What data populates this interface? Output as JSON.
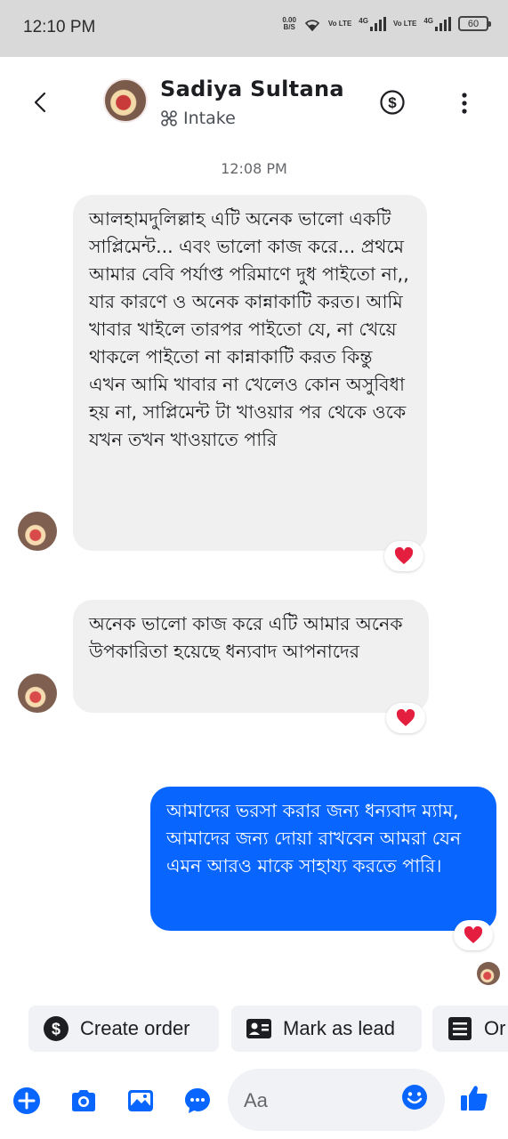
{
  "status_bar": {
    "time": "12:10 PM",
    "net_speed": "0.00",
    "net_unit": "B/S",
    "sim1": "Vo LTE",
    "sim1_type": "4G",
    "sim2": "Vo LTE",
    "sim2_type": "4G",
    "battery": "60"
  },
  "header": {
    "contact_name": "Sadiya Sultana",
    "subtitle": "Intake"
  },
  "conversation": {
    "timestamp": "12:08 PM",
    "messages": [
      {
        "direction": "in",
        "text": "আলহামদুলিল্লাহ এটি অনেক ভালো একটি সাপ্লিমেন্ট... এবং ভালো কাজ করে... প্রথমে আমার বেবি পর্যাপ্ত পরিমাণে দুধ পাইতো না,, যার কারণে ও অনেক কান্নাকাটি করত। আমি খাবার খাইলে তারপর পাইতো যে, না খেয়ে থাকলে পাইতো না কান্নাকাটি করত কিন্তু এখন আমি খাবার না খেলেও কোন অসুবিধা হয় না, সাপ্লিমেন্ট টা খাওয়ার পর থেকে ওকে যখন তখন খাওয়াতে পারি",
        "reaction": "heart"
      },
      {
        "direction": "in",
        "text": "অনেক ভালো কাজ করে এটি আমার অনেক উপকারিতা হয়েছে ধন্যবাদ আপনাদের",
        "reaction": "heart"
      },
      {
        "direction": "out",
        "text": "আমাদের ভরসা করার জন্য ধন্যবাদ ম্যাম, আমাদের জন্য দোয়া রাখবেন আমরা যেন এমন আরও মাকে সাহায্য করতে পারি।",
        "reaction": "heart"
      }
    ]
  },
  "quick_actions": [
    {
      "label": "Create order",
      "icon": "dollar-icon"
    },
    {
      "label": "Mark as lead",
      "icon": "contact-card-icon"
    },
    {
      "label": "Or",
      "icon": "list-icon"
    }
  ],
  "composer": {
    "placeholder": "Aa"
  },
  "colors": {
    "accent": "#0866ff",
    "incoming_bubble": "#f0f0f0",
    "heart": "#e41e3f"
  }
}
